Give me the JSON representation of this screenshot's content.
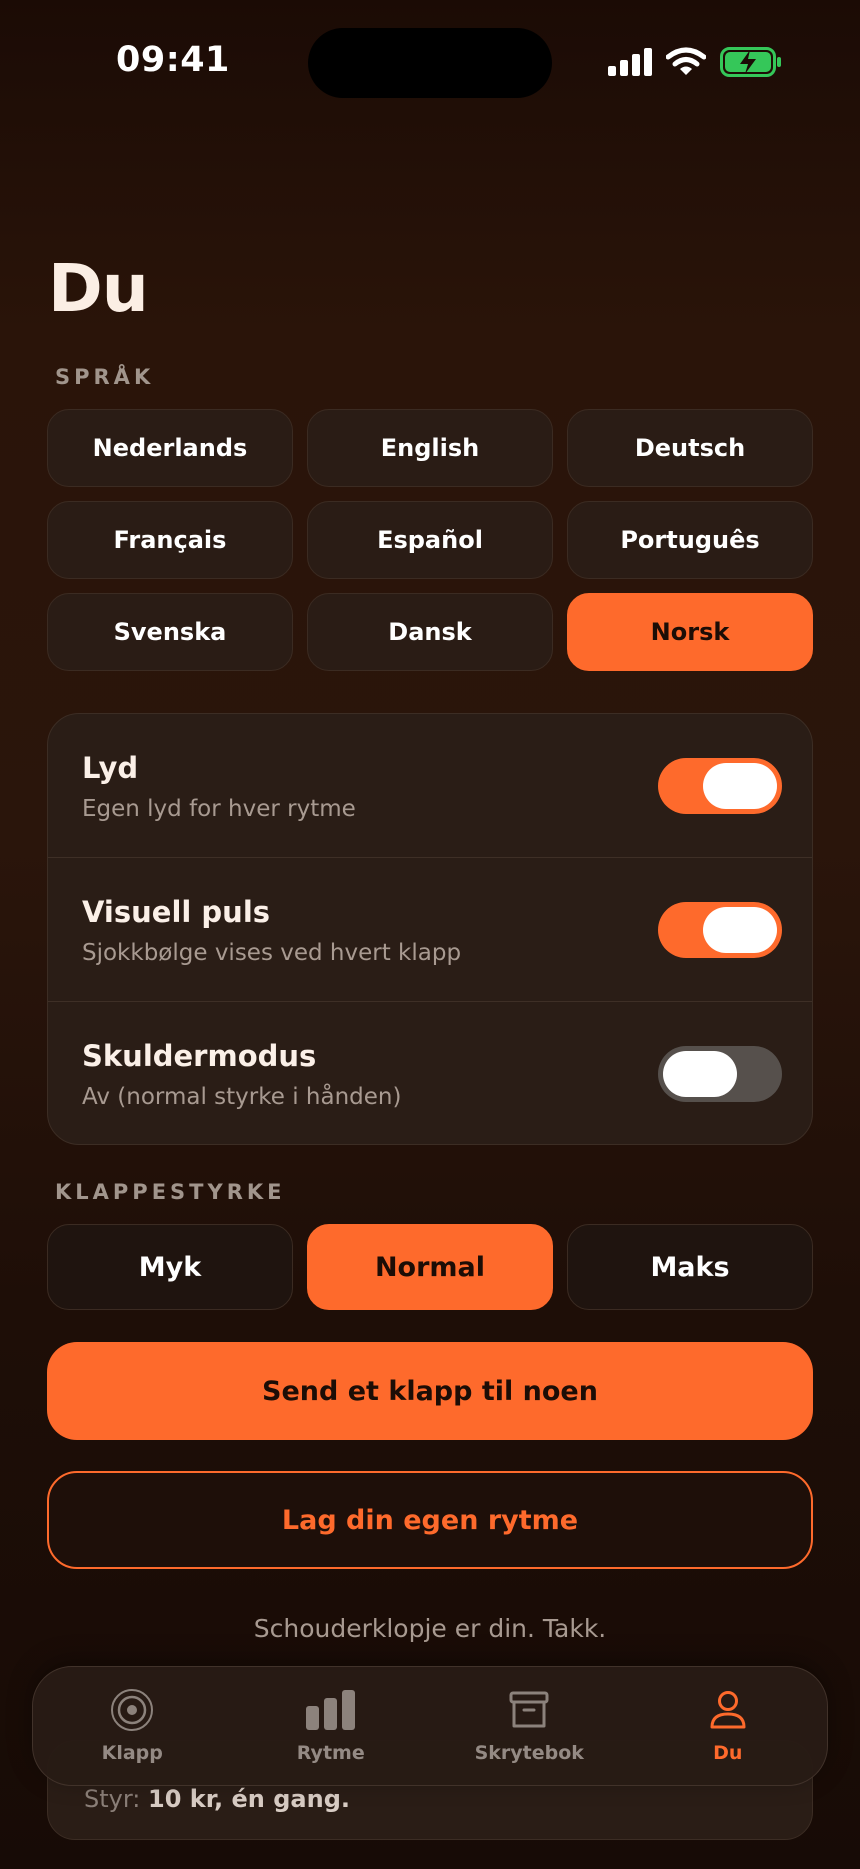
{
  "status_bar": {
    "time": "09:41"
  },
  "page_title": "Du",
  "language": {
    "label": "SPRÅK",
    "options": [
      "Nederlands",
      "English",
      "Deutsch",
      "Français",
      "Español",
      "Português",
      "Svenska",
      "Dansk",
      "Norsk"
    ],
    "selected": "Norsk"
  },
  "settings": [
    {
      "title": "Lyd",
      "subtitle": "Egen lyd for hver rytme",
      "on": true
    },
    {
      "title": "Visuell puls",
      "subtitle": "Sjokkbølge vises ved hvert klapp",
      "on": true
    },
    {
      "title": "Skuldermodus",
      "subtitle": "Av (normal styrke i hånden)",
      "on": false
    }
  ],
  "strength": {
    "label": "KLAPPESTYRKE",
    "options": [
      "Myk",
      "Normal",
      "Maks"
    ],
    "selected": "Normal"
  },
  "actions": {
    "send": "Send et klapp til noen",
    "create": "Lag din egen rytme"
  },
  "footer_text": "Schouderklopje er din. Takk.",
  "hidden_card": {
    "prefix": "Styr:",
    "value": "10 kr, én gang."
  },
  "tabs": [
    {
      "label": "Klapp",
      "icon": "target-icon",
      "active": false
    },
    {
      "label": "Rytme",
      "icon": "bars-icon",
      "active": false
    },
    {
      "label": "Skrytebok",
      "icon": "archive-box-icon",
      "active": false
    },
    {
      "label": "Du",
      "icon": "person-icon",
      "active": true
    }
  ],
  "colors": {
    "accent": "#fe6a2c",
    "battery": "#35c759"
  }
}
